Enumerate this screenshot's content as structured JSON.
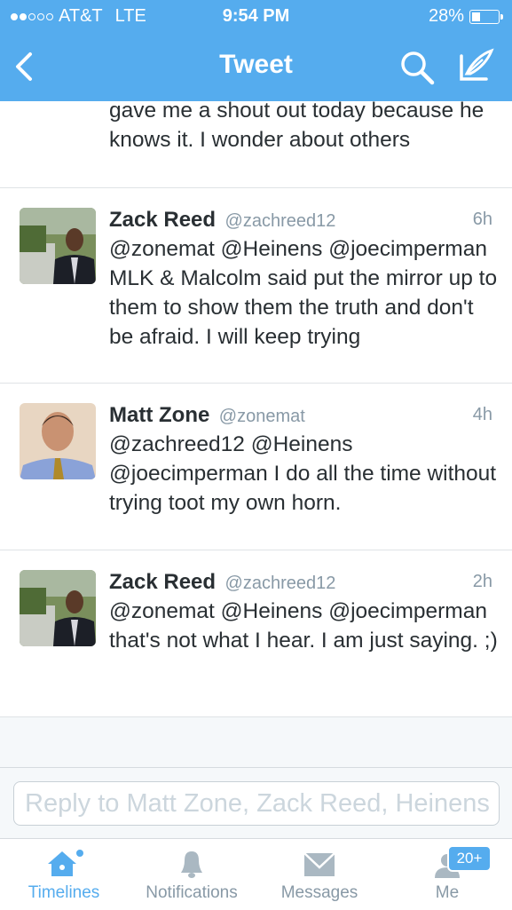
{
  "status_bar": {
    "carrier": "AT&T",
    "network": "LTE",
    "time": "9:54 PM",
    "battery": "28%",
    "battery_level": 0.28
  },
  "nav": {
    "title": "Tweet",
    "back_icon": "chevron-left-icon",
    "search_icon": "search-icon",
    "compose_icon": "compose-icon"
  },
  "tweets": [
    {
      "partial": true,
      "text": "gave me a shout out today because he knows it. I wonder about others"
    },
    {
      "name": "Zack Reed",
      "handle": "@zachreed12",
      "time": "6h",
      "text": "@zonemat @Heinens @joecimperman MLK & Malcolm said put the mirror up to them to show them the truth and don't be afraid. I will keep trying"
    },
    {
      "name": "Matt Zone",
      "handle": "@zonemat",
      "time": "4h",
      "text": "@zachreed12 @Heinens @joecimperman I do all the time without trying toot my own horn."
    },
    {
      "name": "Zack Reed",
      "handle": "@zachreed12",
      "time": "2h",
      "text": "@zonemat @Heinens @joecimperman that's not what I hear. I am just saying. ;)"
    }
  ],
  "reply": {
    "placeholder": "Reply to Matt Zone, Zack Reed, Heinens"
  },
  "tabs": [
    {
      "label": "Timelines",
      "icon": "home-icon",
      "active": true
    },
    {
      "label": "Notifications",
      "icon": "bell-icon",
      "active": false
    },
    {
      "label": "Messages",
      "icon": "envelope-icon",
      "active": false
    },
    {
      "label": "Me",
      "icon": "person-icon",
      "active": false,
      "badge": "20+"
    }
  ],
  "colors": {
    "accent": "#55acee",
    "text": "#292f33",
    "muted": "#8899a6"
  }
}
